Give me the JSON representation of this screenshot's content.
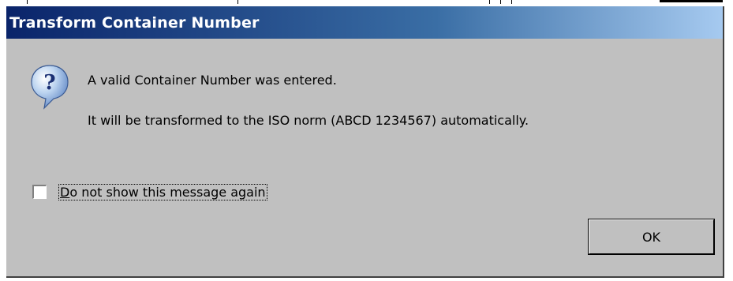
{
  "dialog": {
    "title": "Transform Container Number",
    "icon": "question-icon",
    "message_line1": "A valid Container Number was entered.",
    "message_line2": "It will be transformed to the ISO norm (ABCD  1234567) automatically.",
    "checkbox": {
      "mnemonic": "D",
      "label_rest": "o not show this message again",
      "checked": false
    },
    "ok_label": "OK"
  },
  "colors": {
    "title_start": "#0a246a",
    "title_end": "#a6caf0",
    "face": "#c0c0c0"
  }
}
